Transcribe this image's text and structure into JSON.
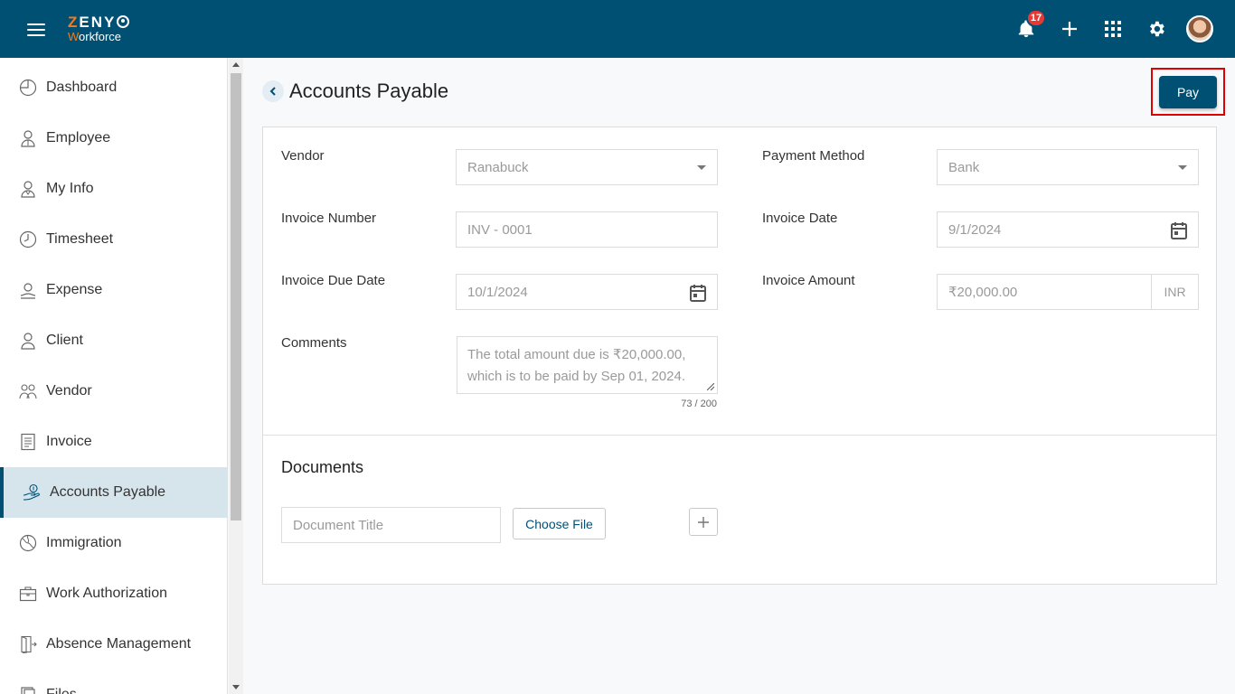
{
  "header": {
    "logo_main_first": "Z",
    "logo_main_rest": "ENY",
    "logo_sub_first": "W",
    "logo_sub_rest": "orkforce",
    "notification_count": "17"
  },
  "sidebar": {
    "items": [
      {
        "label": "Dashboard",
        "icon": "dashboard-icon"
      },
      {
        "label": "Employee",
        "icon": "employee-icon"
      },
      {
        "label": "My Info",
        "icon": "my-info-icon"
      },
      {
        "label": "Timesheet",
        "icon": "clock-icon"
      },
      {
        "label": "Expense",
        "icon": "expense-icon"
      },
      {
        "label": "Client",
        "icon": "client-icon"
      },
      {
        "label": "Vendor",
        "icon": "vendor-icon"
      },
      {
        "label": "Invoice",
        "icon": "invoice-icon"
      },
      {
        "label": "Accounts Payable",
        "icon": "accounts-payable-icon",
        "active": true
      },
      {
        "label": "Immigration",
        "icon": "globe-icon"
      },
      {
        "label": "Work Authorization",
        "icon": "briefcase-icon"
      },
      {
        "label": "Absence Management",
        "icon": "exit-door-icon"
      },
      {
        "label": "Files",
        "icon": "files-icon"
      }
    ]
  },
  "page": {
    "title": "Accounts Payable",
    "pay_label": "Pay"
  },
  "form": {
    "vendor_label": "Vendor",
    "vendor_value": "Ranabuck",
    "payment_method_label": "Payment Method",
    "payment_method_value": "Bank",
    "invoice_number_label": "Invoice Number",
    "invoice_number_value": "INV - 0001",
    "invoice_date_label": "Invoice Date",
    "invoice_date_value": "9/1/2024",
    "invoice_due_date_label": "Invoice Due Date",
    "invoice_due_date_value": "10/1/2024",
    "invoice_amount_label": "Invoice Amount",
    "invoice_amount_value": "₹20,000.00",
    "invoice_amount_currency": "INR",
    "comments_label": "Comments",
    "comments_value": "The total amount due is ₹20,000.00, which is to be paid by Sep 01, 2024.",
    "comments_counter": "73 / 200"
  },
  "documents": {
    "title": "Documents",
    "title_placeholder": "Document Title",
    "choose_file_label": "Choose File"
  },
  "colors": {
    "primary": "#005073",
    "accent": "#f47b20",
    "highlight": "#e00000",
    "badge": "#e53935"
  }
}
